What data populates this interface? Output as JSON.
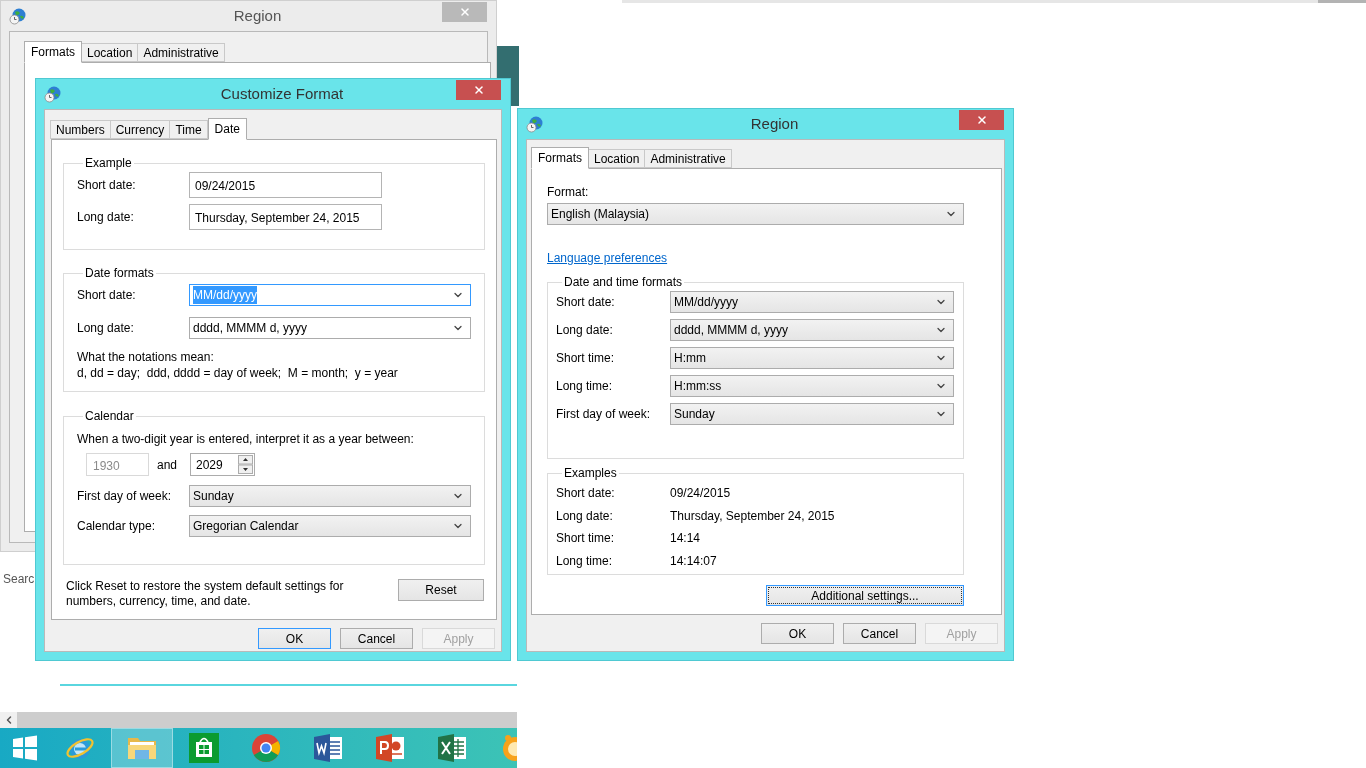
{
  "background_window": {
    "title": "Region",
    "active": false,
    "tabs": [
      {
        "label": "Formats",
        "selected": true
      },
      {
        "label": "Location",
        "selected": false
      },
      {
        "label": "Administrative",
        "selected": false
      }
    ]
  },
  "background_text": "Searc",
  "customize_format": {
    "title": "Customize Format",
    "active": true,
    "tabs": [
      {
        "label": "Numbers",
        "selected": false
      },
      {
        "label": "Currency",
        "selected": false
      },
      {
        "label": "Time",
        "selected": false
      },
      {
        "label": "Date",
        "selected": true
      }
    ],
    "example": {
      "title": "Example",
      "rows": [
        {
          "label": "Short date:",
          "value": "09/24/2015"
        },
        {
          "label": "Long date:",
          "value": "Thursday, September 24, 2015"
        }
      ]
    },
    "date_formats": {
      "title": "Date formats",
      "rows": [
        {
          "label": "Short date:",
          "value": "MM/dd/yyyy",
          "highlighted": true
        },
        {
          "label": "Long date:",
          "value": "dddd, MMMM d, yyyy",
          "highlighted": false
        }
      ],
      "notes": [
        "What the notations mean:",
        "d, dd = day;  ddd, dddd = day of week;  M = month;  y = year"
      ]
    },
    "calendar": {
      "title": "Calendar",
      "prompt": "When a two-digit year is entered, interpret it as a year between:",
      "year_from": {
        "value": "1930",
        "disabled": true
      },
      "and_label": "and",
      "year_to": {
        "value": "2029",
        "disabled": false
      },
      "rows": [
        {
          "label": "First day of week:",
          "value": "Sunday"
        },
        {
          "label": "Calendar type:",
          "value": "Gregorian Calendar"
        }
      ]
    },
    "reset_note": "Click Reset to restore the system default settings for numbers, currency, time, and date.",
    "reset_button": "Reset",
    "buttons": [
      {
        "label": "OK",
        "default": true,
        "disabled": false
      },
      {
        "label": "Cancel",
        "default": false,
        "disabled": false
      },
      {
        "label": "Apply",
        "default": false,
        "disabled": true
      }
    ]
  },
  "region": {
    "title": "Region",
    "active": true,
    "tabs": [
      {
        "label": "Formats",
        "selected": true
      },
      {
        "label": "Location",
        "selected": false
      },
      {
        "label": "Administrative",
        "selected": false
      }
    ],
    "format_label": "Format:",
    "format_value": "English (Malaysia)",
    "language_link": "Language preferences",
    "date_time_formats": {
      "title": "Date and time formats",
      "rows": [
        {
          "label": "Short date:",
          "value": "MM/dd/yyyy"
        },
        {
          "label": "Long date:",
          "value": "dddd, MMMM d, yyyy"
        },
        {
          "label": "Short time:",
          "value": "H:mm"
        },
        {
          "label": "Long time:",
          "value": "H:mm:ss"
        },
        {
          "label": "First day of week:",
          "value": "Sunday"
        }
      ]
    },
    "examples": {
      "title": "Examples",
      "rows": [
        {
          "label": "Short date:",
          "value": "09/24/2015"
        },
        {
          "label": "Long date:",
          "value": "Thursday, September 24, 2015"
        },
        {
          "label": "Short time:",
          "value": "14:14"
        },
        {
          "label": "Long time:",
          "value": "14:14:07"
        }
      ]
    },
    "additional_button": "Additional settings...",
    "buttons": [
      {
        "label": "OK",
        "default": false,
        "disabled": false
      },
      {
        "label": "Cancel",
        "default": false,
        "disabled": false
      },
      {
        "label": "Apply",
        "default": false,
        "disabled": true
      }
    ]
  },
  "taskbar": {
    "apps": [
      {
        "kind": "start",
        "selected": false
      },
      {
        "kind": "browser",
        "selected": false
      },
      {
        "kind": "folder",
        "selected": true
      },
      {
        "kind": "store",
        "selected": false
      },
      {
        "kind": "chrome",
        "selected": false
      },
      {
        "kind": "word",
        "selected": false
      },
      {
        "kind": "powerpoint",
        "selected": false
      },
      {
        "kind": "excel",
        "selected": false
      },
      {
        "kind": "bubble",
        "selected": false
      }
    ]
  }
}
